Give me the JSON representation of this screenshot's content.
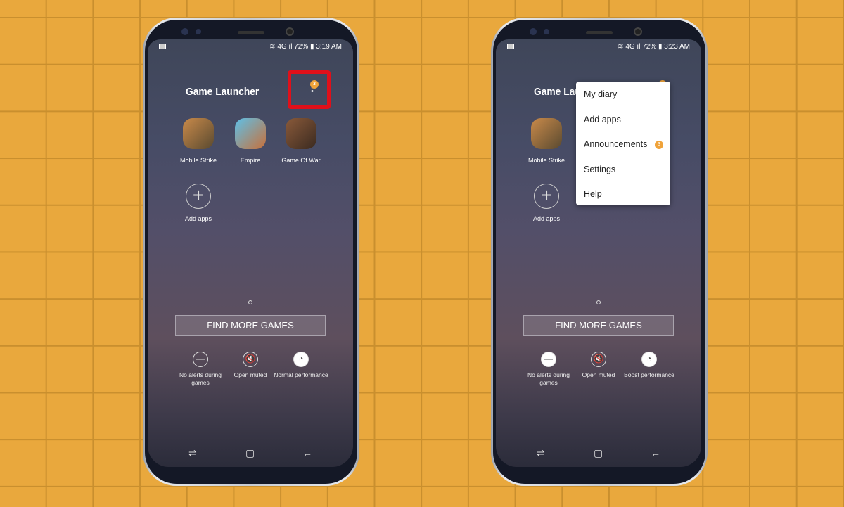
{
  "colors": {
    "background": "#e9a83d",
    "badge": "#f0a33a",
    "highlight": "#e0101a"
  },
  "phones": [
    {
      "status": {
        "signal": "4G",
        "battery": "72%",
        "time": "3:19 AM"
      },
      "title": "Game Launcher",
      "more_badge": "3",
      "games": [
        {
          "label": "Mobile Strike"
        },
        {
          "label": "Empire"
        },
        {
          "label": "Game Of War"
        }
      ],
      "add_apps": "Add apps",
      "find_more": "FIND MORE GAMES",
      "options": [
        {
          "label": "No alerts during games",
          "icon": "minus-circle-icon"
        },
        {
          "label": "Open muted",
          "icon": "mute-icon"
        },
        {
          "label": "Normal performance",
          "icon": "gauge-icon"
        }
      ]
    },
    {
      "status": {
        "signal": "4G",
        "battery": "72%",
        "time": "3:23 AM"
      },
      "title": "Game Launcher",
      "more_badge": "3",
      "games": [
        {
          "label": "Mobile Strike"
        }
      ],
      "add_apps": "Add apps",
      "find_more": "FIND MORE GAMES",
      "options": [
        {
          "label": "No alerts during games",
          "icon": "minus-circle-icon"
        },
        {
          "label": "Open muted",
          "icon": "mute-icon"
        },
        {
          "label": "Boost performance",
          "icon": "gauge-icon"
        }
      ],
      "menu": [
        {
          "label": "My diary"
        },
        {
          "label": "Add apps"
        },
        {
          "label": "Announcements",
          "badge": "3"
        },
        {
          "label": "Settings"
        },
        {
          "label": "Help"
        }
      ]
    }
  ]
}
